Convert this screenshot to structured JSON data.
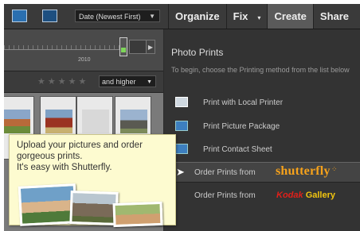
{
  "toolbar": {
    "sort_selected": "Date (Newest First)",
    "tabs": [
      {
        "label": "Organize"
      },
      {
        "label": "Fix"
      },
      {
        "label": "Create"
      },
      {
        "label": "Share"
      }
    ],
    "active_tab": "Create"
  },
  "timeline": {
    "year": "2010"
  },
  "filter": {
    "stars": "★★★★★",
    "rating_selected": "and higher"
  },
  "promo": {
    "line1": "Upload your pictures and order",
    "line2": "gorgeous prints.",
    "line3": "It's easy with Shutterfly."
  },
  "panel": {
    "title": "Photo Prints",
    "description": "To begin, choose the Printing method from the list below",
    "options": [
      {
        "label": "Print with Local Printer",
        "icon": "printer-icon"
      },
      {
        "label": "Print Picture Package",
        "icon": "picture-package-icon"
      },
      {
        "label": "Print Contact Sheet",
        "icon": "contact-sheet-icon"
      },
      {
        "label": "Order Prints from",
        "provider": "shutterfly",
        "provider_dots": "⁘"
      },
      {
        "label": "Order Prints from",
        "provider_k": "Kodak",
        "provider_g": "Gallery"
      }
    ]
  },
  "colors": {
    "accent_orange": "#f6a21b",
    "kodak_red": "#e0201a",
    "kodak_yellow": "#f1c40f",
    "promo_bg": "#fdfbd0"
  }
}
